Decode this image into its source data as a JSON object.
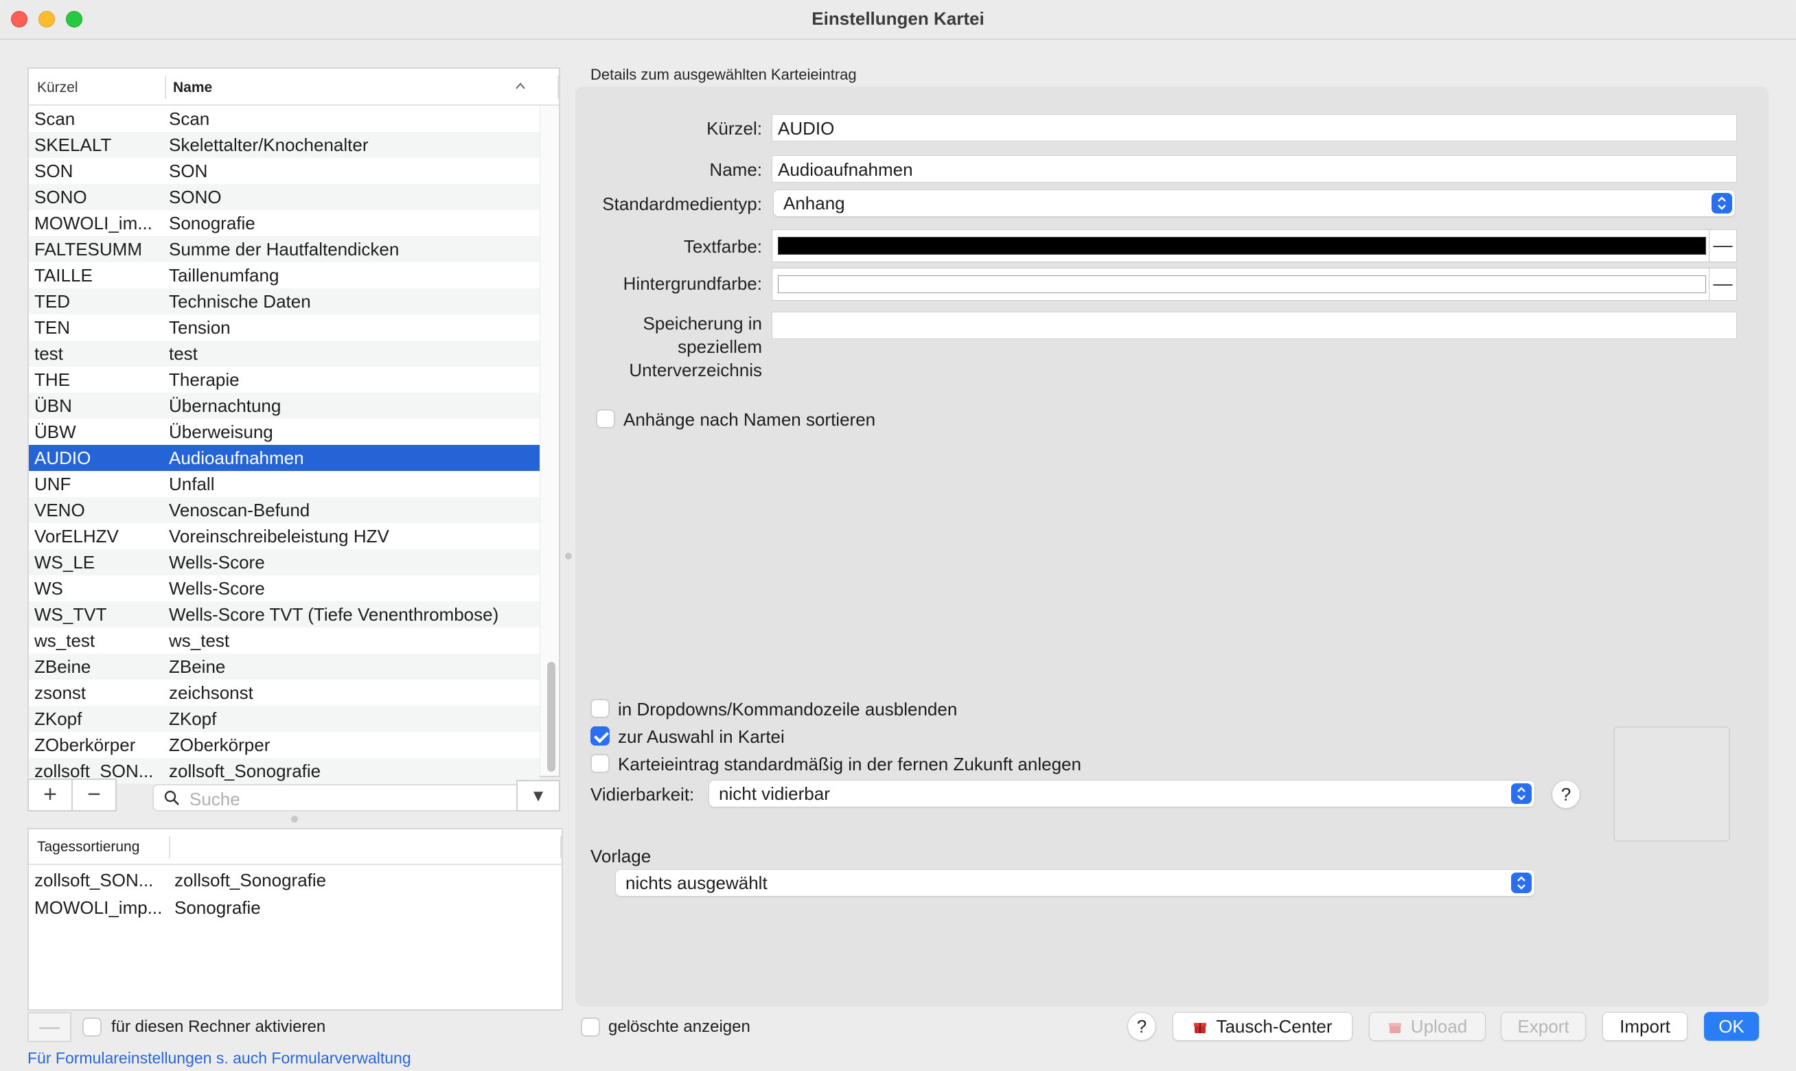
{
  "window": {
    "title": "Einstellungen Kartei"
  },
  "list": {
    "header_kurz": "Kürzel",
    "header_name": "Name",
    "sort_icon": "chevron-up-icon",
    "rows": [
      {
        "kurz": "Scan",
        "name": "Scan"
      },
      {
        "kurz": "SKELALT",
        "name": "Skelettalter/Knochenalter"
      },
      {
        "kurz": "SON",
        "name": "SON"
      },
      {
        "kurz": "SONO",
        "name": "SONO"
      },
      {
        "kurz": "MOWOLI_im...",
        "name": "Sonografie"
      },
      {
        "kurz": "FALTESUMM",
        "name": "Summe der Hautfaltendicken"
      },
      {
        "kurz": "TAILLE",
        "name": "Taillenumfang"
      },
      {
        "kurz": "TED",
        "name": "Technische Daten"
      },
      {
        "kurz": "TEN",
        "name": "Tension"
      },
      {
        "kurz": "test",
        "name": "test"
      },
      {
        "kurz": "THE",
        "name": "Therapie"
      },
      {
        "kurz": "ÜBN",
        "name": "Übernachtung"
      },
      {
        "kurz": "ÜBW",
        "name": "Überweisung"
      },
      {
        "kurz": "AUDIO",
        "name": "Audioaufnahmen"
      },
      {
        "kurz": "UNF",
        "name": "Unfall"
      },
      {
        "kurz": "VENO",
        "name": "Venoscan-Befund"
      },
      {
        "kurz": "VorELHZV",
        "name": "Voreinschreibeleistung HZV"
      },
      {
        "kurz": "WS_LE",
        "name": "Wells-Score"
      },
      {
        "kurz": "WS",
        "name": "Wells-Score"
      },
      {
        "kurz": "WS_TVT",
        "name": "Wells-Score TVT (Tiefe Venenthrombose)"
      },
      {
        "kurz": "ws_test",
        "name": "ws_test"
      },
      {
        "kurz": "ZBeine",
        "name": "ZBeine"
      },
      {
        "kurz": "zsonst",
        "name": "zeichsonst"
      },
      {
        "kurz": "ZKopf",
        "name": "ZKopf"
      },
      {
        "kurz": "ZOberkörper",
        "name": "ZOberkörper"
      },
      {
        "kurz": "zollsoft_SON...",
        "name": "zollsoft_Sonografie"
      }
    ],
    "selected_kurz": "AUDIO",
    "add_label": "+",
    "remove_label": "−",
    "search_placeholder": "Suche",
    "filter_label": "▼"
  },
  "day_sort": {
    "header": "Tagessortierung",
    "rows": [
      {
        "kurz": "zollsoft_SON...",
        "name": "zollsoft_Sonografie"
      },
      {
        "kurz": "MOWOLI_imp...",
        "name": "Sonografie"
      }
    ],
    "remove_label": "—",
    "activate_label": "für diesen Rechner aktivieren",
    "activate_checked": false
  },
  "footer_link": "Für Formulareinstellungen s. auch Formularverwaltung",
  "details": {
    "title": "Details zum ausgewählten Karteieintrag",
    "kuerzel_label": "Kürzel:",
    "kuerzel_value": "AUDIO",
    "name_label": "Name:",
    "name_value": "Audioaufnahmen",
    "medientyp_label": "Standardmedientyp:",
    "medientyp_value": "Anhang",
    "textfarbe_label": "Textfarbe:",
    "textfarbe_color": "#000000",
    "hintergrund_label": "Hintergrundfarbe:",
    "hintergrund_color": "#ffffff",
    "color_minus": "—",
    "speicherung_line1": "Speicherung in",
    "speicherung_line2": "speziellem",
    "speicherung_line3": "Unterverzeichnis",
    "speicherung_value": "",
    "sort_by_name_label": "Anhänge nach Namen sortieren",
    "sort_by_name_checked": false,
    "hide_dropdown_label": "in Dropdowns/Kommandozeile ausblenden",
    "hide_dropdown_checked": false,
    "select_in_kartei_label": "zur Auswahl in Kartei",
    "select_in_kartei_checked": true,
    "future_label": "Karteieintrag standardmäßig in der fernen Zukunft anlegen",
    "future_checked": false,
    "vidier_label": "Vidierbarkeit:",
    "vidier_value": "nicht vidierbar",
    "help_label": "?",
    "vorlage_label": "Vorlage",
    "vorlage_value": "nichts ausgewählt"
  },
  "bottom": {
    "show_deleted_label": "gelöschte anzeigen",
    "show_deleted_checked": false,
    "help_label": "?",
    "tausch_label": "Tausch-Center",
    "upload_label": "Upload",
    "export_label": "Export",
    "import_label": "Import",
    "ok_label": "OK"
  },
  "colors": {
    "accent": "#2a6ff0",
    "selection": "#2464d6",
    "link": "#2966d6"
  }
}
